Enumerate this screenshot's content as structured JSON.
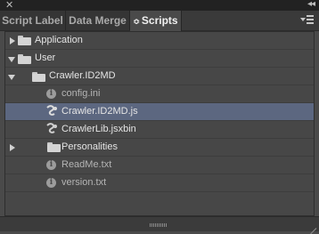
{
  "window": {
    "close_glyph": "✕",
    "collapse_glyph": "◂◂"
  },
  "tabs": [
    {
      "label": "Script Label",
      "active": false
    },
    {
      "label": "Data Merge",
      "active": false
    },
    {
      "label": "Scripts",
      "active": true
    }
  ],
  "tab_arrows_glyph": "≎",
  "tree": {
    "rows": [
      {
        "label": "Application",
        "type": "folder",
        "expander": "collapsed"
      },
      {
        "label": "User",
        "type": "folder",
        "expander": "expanded"
      },
      {
        "label": "Crawler.ID2MD",
        "type": "folder",
        "expander": "expanded"
      },
      {
        "label": "config.ini",
        "type": "info-file",
        "expander": "none"
      },
      {
        "label": "Crawler.ID2MD.js",
        "type": "script",
        "expander": "none",
        "selected": true
      },
      {
        "label": "CrawlerLib.jsxbin",
        "type": "script",
        "expander": "none"
      },
      {
        "label": "Personalities",
        "type": "folder",
        "expander": "collapsed"
      },
      {
        "label": "ReadMe.txt",
        "type": "info-file",
        "expander": "none"
      },
      {
        "label": "version.txt",
        "type": "info-file",
        "expander": "none"
      }
    ]
  },
  "info_glyph": "i",
  "colors": {
    "selection": "#5c6780",
    "panel": "#474747",
    "tabbar": "#3a3a3a"
  }
}
